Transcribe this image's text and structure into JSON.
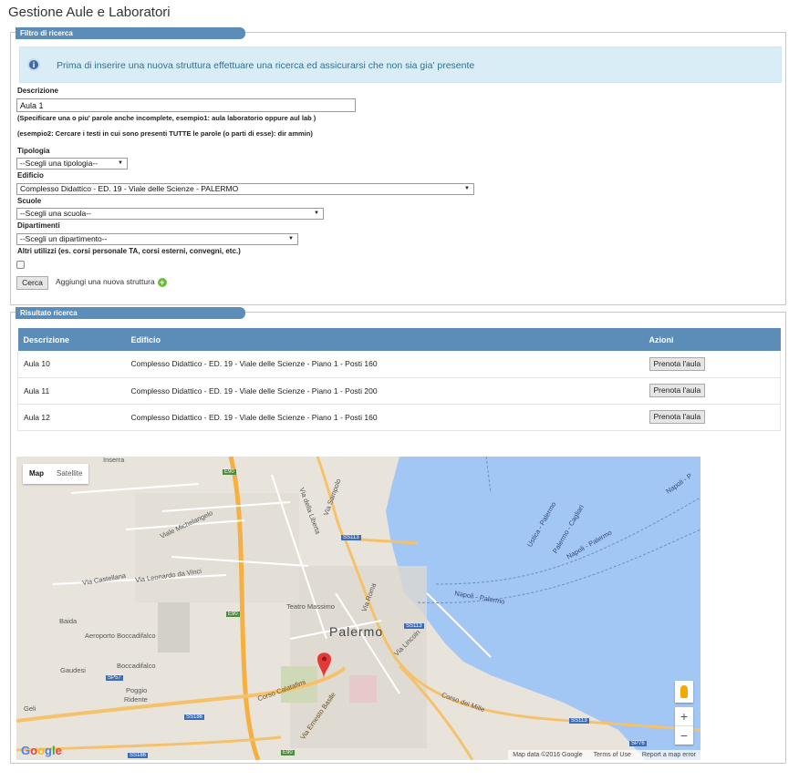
{
  "page_title": "Gestione Aule e Laboratori",
  "filter": {
    "legend": "Filtro di ricerca",
    "alert_text": "Prima di inserire una nuova struttura effettuare una ricerca ed assicurarsi che non sia gia' presente",
    "descrizione_label": "Descrizione",
    "descrizione_value": "Aula 1",
    "hint1": "(Specificare una o piu' parole anche incomplete, esempio1: aula laboratorio oppure aul lab )",
    "hint2": "(esempio2: Cercare i testi in cui sono presenti TUTTE le parole (o parti di esse): dir ammin)",
    "tipologia_label": "Tipologia",
    "tipologia_value": "--Scegli una tipologia--",
    "edificio_label": "Edificio",
    "edificio_value": "Complesso Didattico - ED. 19 - Viale delle Scienze - PALERMO",
    "scuole_label": "Scuole",
    "scuole_value": "--Scegli una scuola--",
    "dipartimenti_label": "Dipartimenti",
    "dipartimenti_value": "--Scegli un dipartimento--",
    "altri_label": "Altri utilizzi (es. corsi personale TA, corsi esterni, convegni, etc.)",
    "cerca_label": "Cerca",
    "aggiungi_label": "Aggiungi una nuova struttura"
  },
  "results": {
    "legend": "Risultato ricerca",
    "columns": [
      "Descrizione",
      "Edificio",
      "Azioni"
    ],
    "rows": [
      {
        "descrizione": "Aula 10",
        "edificio": "Complesso Didattico - ED. 19 - Viale delle Scienze - Piano 1 - Posti 160",
        "azione": "Prenota l'aula"
      },
      {
        "descrizione": "Aula 11",
        "edificio": "Complesso Didattico - ED. 19 - Viale delle Scienze - Piano 1 - Posti 200",
        "azione": "Prenota l'aula"
      },
      {
        "descrizione": "Aula 12",
        "edificio": "Complesso Didattico - ED. 19 - Viale delle Scienze - Piano 1 - Posti 160",
        "azione": "Prenota l'aula"
      }
    ]
  },
  "map": {
    "tab_map": "Map",
    "tab_satellite": "Satellite",
    "city_label": "Palermo",
    "labels": {
      "teatro": "Teatro Massimo",
      "aeroporto": "Aeroporto Boccadifalco",
      "boccadifalco": "Boccadifalco",
      "baida": "Baida",
      "gaudesi": "Gaudesi",
      "poggio": "Poggio",
      "ridente": "Ridente",
      "napoli1": "Napoli - Palermo",
      "napoli2": "Napoli - Palermo",
      "napoli3": "Napoli - P",
      "ustica": "Ustica - Palermo",
      "cagliari": "Palermo - Cagliari",
      "calatafimi": "Corso Calatafimi",
      "basile": "Via Ernesto Basile",
      "michelangelo": "Viale Michelangelo",
      "castellana": "Via Castellana",
      "leonardo": "Via Leonardo da Vinci",
      "roma": "Via Roma",
      "liberta": "Via della Liberta",
      "lincoln": "Via Lincoln",
      "mille": "Corso dei Mille",
      "sampolo": "Via Sampolo",
      "inserra": "Inserra",
      "geli": "Geli",
      "e90a": "E90",
      "e90b": "E90",
      "e90c": "E90",
      "ss113a": "SS113",
      "ss113b": "SS113",
      "ss113c": "SS113",
      "sp57": "SP57",
      "ss186a": "SS186",
      "ss186b": "SS186",
      "sp76": "SP76"
    },
    "footer_data": "Map data ©2016 Google",
    "footer_terms": "Terms of Use",
    "footer_report": "Report a map error",
    "zoom_in": "+",
    "zoom_out": "−",
    "colors": {
      "water": "#a3c7f5",
      "land": "#e8e4dc",
      "highway": "#f5b041",
      "road": "#ffffff",
      "marker": "#e53935"
    }
  }
}
